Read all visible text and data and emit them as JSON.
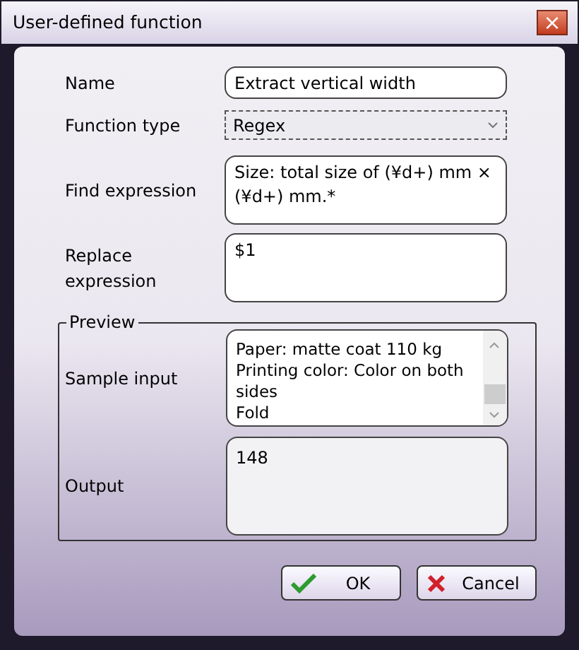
{
  "window": {
    "title": "User-defined function",
    "close": "×"
  },
  "fields": [
    {
      "label": "Name",
      "kind": "text",
      "value": "Extract vertical width"
    },
    {
      "label": "Function type",
      "kind": "select",
      "value": "Regex"
    },
    {
      "label": "Find expression",
      "kind": "area",
      "value": "Size: total size of (¥d+) mm × (¥d+) mm.*"
    },
    {
      "label": "Replace expression",
      "kind": "area",
      "value": "$1"
    }
  ],
  "preview": {
    "title": "Preview",
    "sample_input": {
      "label": "Sample input",
      "lines": [
        "Paper: matte coat 110 kg",
        "Printing color: Color on both sides",
        "Fold"
      ]
    },
    "output": {
      "label": "Output",
      "value": "148"
    }
  },
  "buttons": [
    {
      "label": "OK",
      "kind": "ok"
    },
    {
      "label": "Cancel",
      "kind": "cancel"
    }
  ]
}
